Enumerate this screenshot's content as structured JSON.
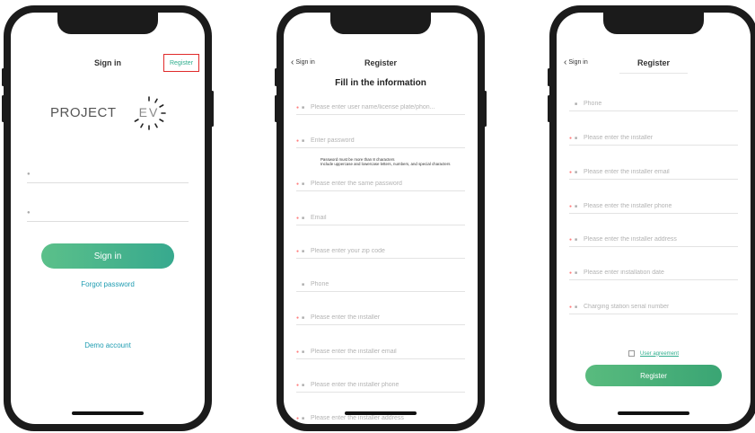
{
  "screen1": {
    "title": "Sign in",
    "register_link": "Register",
    "logo_brand": "PROJECT",
    "logo_ev": "EV",
    "username_icon": "user-icon",
    "password_icon": "lock-icon",
    "signin_button": "Sign in",
    "forgot_password": "Forgot password",
    "demo_account": "Demo account"
  },
  "screen2": {
    "back_label": "Sign in",
    "title": "Register",
    "form_title": "Fill in the information",
    "fields": [
      {
        "label": "Please enter user name/license plate/phon...",
        "required": true,
        "icon": "user-icon"
      },
      {
        "label": "Enter password",
        "required": true,
        "icon": "lock-icon"
      },
      {
        "label": "Please enter the same password",
        "required": true,
        "icon": "lock-icon"
      },
      {
        "label": "Email",
        "required": true,
        "icon": "mail-icon"
      },
      {
        "label": "Please enter your zip code",
        "required": true,
        "icon": "location-icon"
      },
      {
        "label": "Phone",
        "required": false,
        "icon": "phone-icon"
      },
      {
        "label": "Please enter the installer",
        "required": true,
        "icon": "user-icon"
      },
      {
        "label": "Please enter the installer email",
        "required": true,
        "icon": "mail-icon"
      },
      {
        "label": "Please enter the installer phone",
        "required": true,
        "icon": "phone-icon"
      },
      {
        "label": "Please enter the installer address",
        "required": true,
        "icon": "location-icon"
      }
    ],
    "password_hint": "Password must be more than 8 characters\nInclude uppercase and lowercase letters, numbers, and special characters"
  },
  "screen3": {
    "back_label": "Sign in",
    "title": "Register",
    "fields": [
      {
        "label": "Phone",
        "required": false,
        "icon": "phone-icon"
      },
      {
        "label": "Please enter the installer",
        "required": true,
        "icon": "user-icon"
      },
      {
        "label": "Please enter the installer email",
        "required": true,
        "icon": "mail-icon"
      },
      {
        "label": "Please enter the installer phone",
        "required": true,
        "icon": "phone-icon"
      },
      {
        "label": "Please enter the installer address",
        "required": true,
        "icon": "location-icon"
      },
      {
        "label": "Please enter installation date",
        "required": true,
        "icon": "calendar-icon"
      },
      {
        "label": "Charging station serial number",
        "required": true,
        "icon": "serial-icon"
      }
    ],
    "agreement_label": "User agreement",
    "register_button": "Register"
  },
  "colors": {
    "accent_green": "#37a98e",
    "link_teal": "#1e9cb1",
    "highlight_red": "#e02a2a",
    "frame": "#1b1b1b"
  }
}
